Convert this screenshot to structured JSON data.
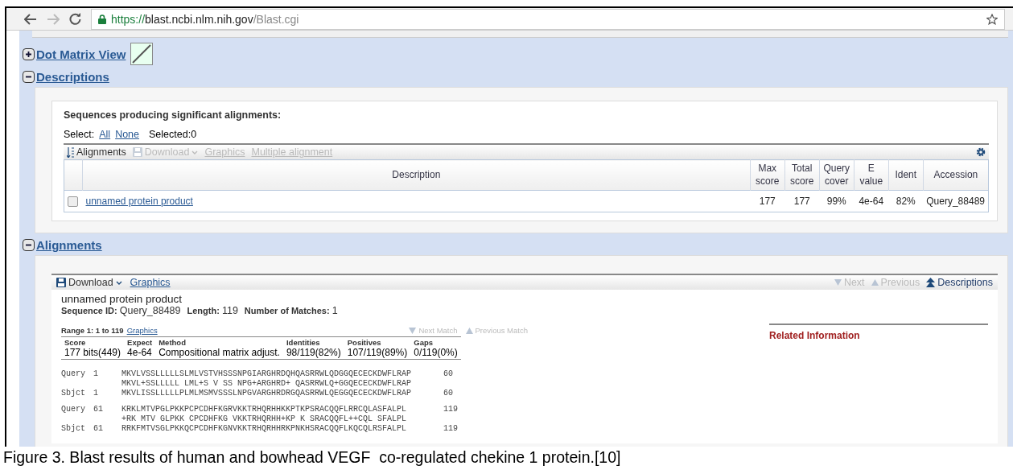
{
  "browser": {
    "url": {
      "scheme": "https://",
      "host": "blast.ncbi.nlm.nih.gov",
      "path": "/Blast.cgi"
    }
  },
  "sections": [
    {
      "title": "Dot Matrix View",
      "expanded": false
    },
    {
      "title": "Descriptions",
      "expanded": true
    },
    {
      "title": "Alignments",
      "expanded": true
    }
  ],
  "descriptions": {
    "heading": "Sequences producing significant alignments:",
    "select_label": "Select:",
    "select_links": [
      "All",
      "None"
    ],
    "selected_count": "Selected:0",
    "toolbar": [
      {
        "label": "Alignments",
        "kind": "sort",
        "disabled": false
      },
      {
        "label": "Download",
        "kind": "download",
        "disabled": true
      },
      {
        "label": "Graphics",
        "kind": "link",
        "disabled": true
      },
      {
        "label": "Multiple alignment",
        "kind": "link",
        "disabled": true
      }
    ],
    "table": {
      "columns": [
        "Description",
        "Max score",
        "Total score",
        "Query cover",
        "E value",
        "Ident",
        "Accession"
      ],
      "rows": [
        {
          "checked": false,
          "cells": [
            "unnamed protein product",
            "177",
            "177",
            "99%",
            "4e-64",
            "82%",
            "Query_88489"
          ]
        }
      ]
    }
  },
  "alignments": {
    "toolbar": [
      {
        "label": "Download",
        "kind": "download"
      },
      {
        "label": "Graphics",
        "kind": "link"
      }
    ],
    "nav": [
      {
        "label": "Next",
        "kind": "down",
        "disabled": true
      },
      {
        "label": "Previous",
        "kind": "up",
        "disabled": true
      },
      {
        "label": "Descriptions",
        "kind": "top",
        "disabled": false
      }
    ],
    "title": "unnamed protein product",
    "meta": [
      {
        "label": "Sequence ID:",
        "value": "Query_88489"
      },
      {
        "label": "Length:",
        "value": "119"
      },
      {
        "label": "Number of Matches:",
        "value": "1"
      }
    ],
    "range": "Range 1: 1 to 119",
    "range_link": "Graphics",
    "match_nav": [
      {
        "label": "Next Match",
        "kind": "down",
        "disabled": true
      },
      {
        "label": "Previous Match",
        "kind": "up",
        "disabled": true
      }
    ],
    "stats": {
      "columns": [
        "Score",
        "Expect",
        "Method",
        "Identities",
        "Positives",
        "Gaps"
      ],
      "values": [
        "177 bits(449)",
        "4e-64",
        "Compositional matrix adjust.",
        "98/119(82%)",
        "107/119(89%)",
        "0/119(0%)"
      ]
    },
    "blocks": [
      {
        "lines": [
          {
            "label": "Query",
            "start": "1",
            "seq": "MKVLVSSLLLLLSLMLVSTVHSSSNPGIARGHRDQHQASRRWLQDGGQECECKDWFLRAP",
            "end": "60"
          },
          {
            "seq": "MKVL+SSLLLLL LML+S V SS NPG+ARGHRD+ QASRRWLQ+GGQECECKDWFLRAP"
          },
          {
            "label": "Sbjct",
            "start": "1",
            "seq": "MKVLISSLLLLLPLMLMSMVSSSLNPGVARGHRDRGQASRRWLQEGGQECECKDWFLRAP",
            "end": "60"
          }
        ]
      },
      {
        "lines": [
          {
            "label": "Query",
            "start": "61",
            "seq": "KRKLMTVPGLPKKPCPCDHFKGRVKKTRHQRHHKKPTKPSRACQQFLRRCQLASFALPL",
            "end": "119"
          },
          {
            "seq": "+RK MTV GLPKK CPCDHFKG VKKTRHQRHH+KP K SRACQQFL++CQL SFALPL"
          },
          {
            "label": "Sbjct",
            "start": "61",
            "seq": "RRKFMTVSGLPKKQCPCDHFKGNVKKTRHQRHHRKPNKHSRACQQFLKQCQLRSFALPL",
            "end": "119"
          }
        ]
      }
    ],
    "related": "Related Information"
  },
  "caption": "Figure 3. Blast results of human and bowhead VEGF  co-regulated chekine 1 protein.[10]"
}
